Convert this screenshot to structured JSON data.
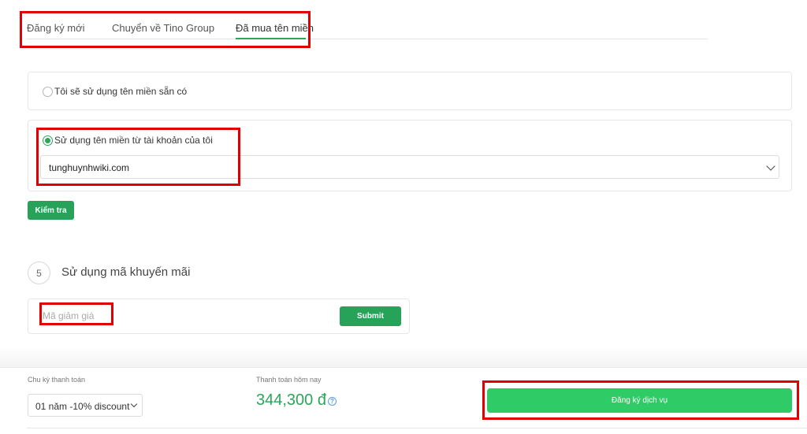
{
  "tabs": [
    {
      "label": "Đăng ký mới",
      "active": false
    },
    {
      "label": "Chuyển về Tino Group",
      "active": false
    },
    {
      "label": "Đã mua tên miền",
      "active": true
    }
  ],
  "options": {
    "existing_domain_label": "Tôi sẽ sử dụng tên miền sẵn có",
    "account_domain_label": "Sử dụng tên miền từ tài khoản của tôi",
    "selected_domain": "tunghuynhwiki.com",
    "check_button": "Kiểm tra"
  },
  "promo": {
    "step_number": "5",
    "title": "Sử dụng mã khuyến mãi",
    "placeholder": "Mã giảm giá",
    "submit_button": "Submit"
  },
  "footer": {
    "billing_cycle_label": "Chu kỳ thanh toán",
    "billing_cycle_value": "01 năm -10% discount",
    "pay_today_label": "Thanh toán hôm nay",
    "price": "344,300 đ",
    "register_button": "Đăng ký dịch vụ"
  },
  "colors": {
    "accent_green": "#26a358",
    "button_green": "#2ecb67",
    "highlight_red": "#e00000"
  }
}
